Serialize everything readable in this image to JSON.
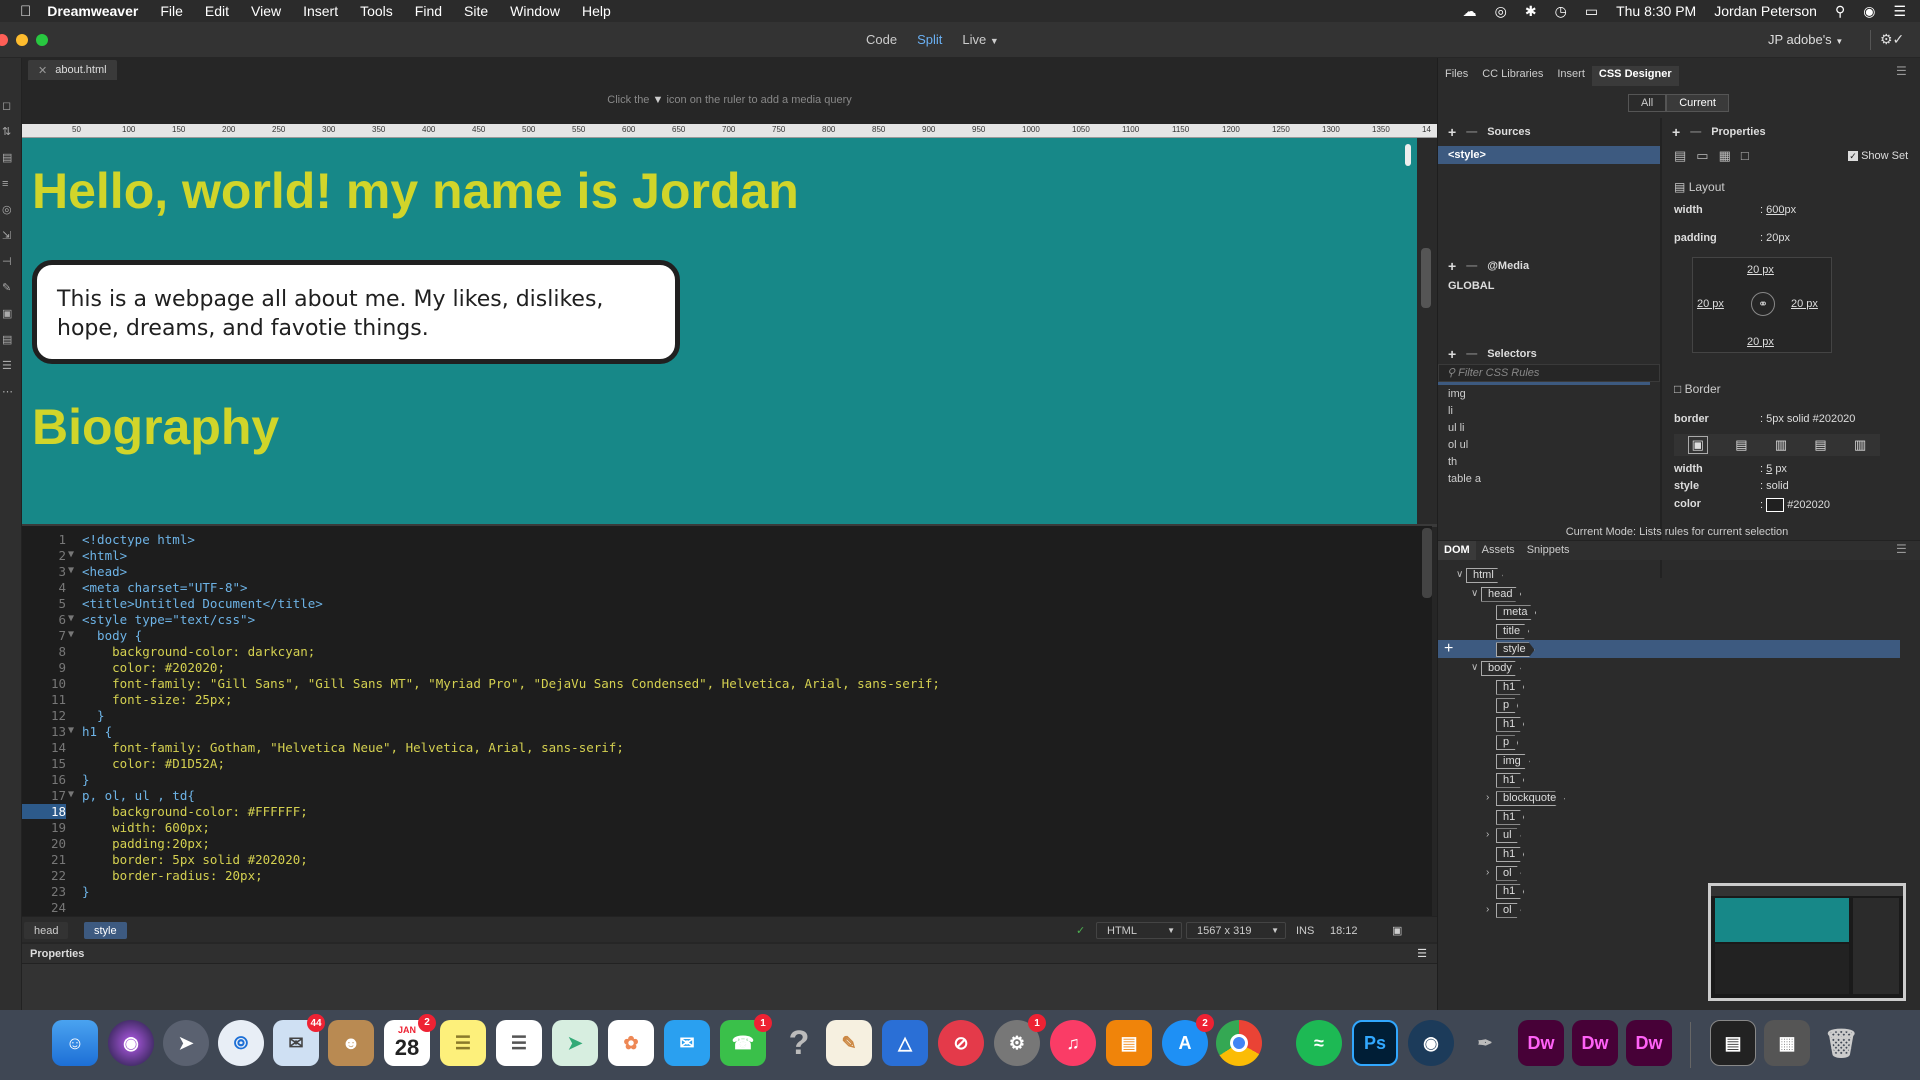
{
  "menubar": {
    "app": "Dreamweaver",
    "items": [
      "File",
      "Edit",
      "View",
      "Insert",
      "Tools",
      "Find",
      "Site",
      "Window",
      "Help"
    ],
    "clock": "Thu 8:30 PM",
    "user": "Jordan Peterson"
  },
  "titlebar": {
    "view_code": "Code",
    "view_split": "Split",
    "view_live": "Live",
    "account": "JP adobe's"
  },
  "document": {
    "tab_label": "about.html",
    "media_hint_left": "Click the",
    "media_hint_right": "icon on the ruler to add a media query",
    "ruler_ticks": [
      "50",
      "100",
      "150",
      "200",
      "250",
      "300",
      "350",
      "400",
      "450",
      "500",
      "550",
      "600",
      "650",
      "700",
      "750",
      "800",
      "850",
      "900",
      "950",
      "1000",
      "1050",
      "1100",
      "1150",
      "1200",
      "1250",
      "1300",
      "1350",
      "14"
    ]
  },
  "live_view": {
    "heading1": "Hello, world! my name is Jordan",
    "paragraph": "This is a webpage all about me. My likes, dislikes, hope, dreams, and favotie things.",
    "heading2": "Biography",
    "colors": {
      "background": "#178888",
      "heading": "#D1D52A",
      "text": "#202020"
    }
  },
  "code_lines": [
    {
      "n": "1",
      "fold": "",
      "text": "<!doctype html>"
    },
    {
      "n": "2",
      "fold": "▼",
      "text": "<html>"
    },
    {
      "n": "3",
      "fold": "▼",
      "text": "<head>"
    },
    {
      "n": "4",
      "fold": "",
      "text": "<meta charset=\"UTF-8\">"
    },
    {
      "n": "5",
      "fold": "",
      "text": "<title>Untitled Document</title>"
    },
    {
      "n": "6",
      "fold": "▼",
      "text": "<style type=\"text/css\">"
    },
    {
      "n": "7",
      "fold": "▼",
      "text": "  body {"
    },
    {
      "n": "8",
      "fold": "",
      "text": "    background-color: darkcyan;"
    },
    {
      "n": "9",
      "fold": "",
      "text": "    color: #202020;"
    },
    {
      "n": "10",
      "fold": "",
      "text": "    font-family: \"Gill Sans\", \"Gill Sans MT\", \"Myriad Pro\", \"DejaVu Sans Condensed\", Helvetica, Arial, sans-serif;"
    },
    {
      "n": "11",
      "fold": "",
      "text": "    font-size: 25px;"
    },
    {
      "n": "12",
      "fold": "",
      "text": "  }"
    },
    {
      "n": "13",
      "fold": "▼",
      "text": "h1 {"
    },
    {
      "n": "14",
      "fold": "",
      "text": "    font-family: Gotham, \"Helvetica Neue\", Helvetica, Arial, sans-serif;"
    },
    {
      "n": "15",
      "fold": "",
      "text": "    color: #D1D52A;"
    },
    {
      "n": "16",
      "fold": "",
      "text": "}"
    },
    {
      "n": "17",
      "fold": "▼",
      "text": "p, ol, ul , td{"
    },
    {
      "n": "18",
      "fold": "",
      "text": "    background-color: #FFFFFF;"
    },
    {
      "n": "19",
      "fold": "",
      "text": "    width: 600px;"
    },
    {
      "n": "20",
      "fold": "",
      "text": "    padding:20px;"
    },
    {
      "n": "21",
      "fold": "",
      "text": "    border: 5px solid #202020;"
    },
    {
      "n": "22",
      "fold": "",
      "text": "    border-radius: 20px;"
    },
    {
      "n": "23",
      "fold": "",
      "text": "}"
    },
    {
      "n": "24",
      "fold": "",
      "text": ""
    }
  ],
  "statusbar": {
    "breadcrumb": [
      "head",
      "style"
    ],
    "language": "HTML",
    "size": "1567 x 319",
    "mode": "INS",
    "position": "18:12"
  },
  "properties_panel": {
    "title": "Properties"
  },
  "right_panel": {
    "tabs": [
      "Files",
      "CC Libraries",
      "Insert",
      "CSS Designer"
    ],
    "seg_all": "All",
    "seg_current": "Current",
    "sources_title": "Sources",
    "source_item": "<style>",
    "media_title": "@Media",
    "media_item": "GLOBAL",
    "selectors_title": "Selectors",
    "filter_placeholder": "Filter CSS Rules",
    "selectors": [
      "img",
      "li",
      "ul li",
      "ol ul",
      "th",
      "table a"
    ],
    "properties_title": "Properties",
    "show_set": "Show Set",
    "layout_title": "Layout",
    "width_label": "width",
    "width_value": "600",
    "width_unit": "px",
    "padding_label": "padding",
    "padding_value": "20px",
    "box_top": "20 px",
    "box_left": "20 px",
    "box_right": "20 px",
    "box_bottom": "20 px",
    "border_title": "Border",
    "border_label": "border",
    "border_value": "5px solid #202020",
    "bwidth_label": "width",
    "bwidth_value": "5",
    "bwidth_unit": "px",
    "bstyle_label": "style",
    "bstyle_value": "solid",
    "bcolor_label": "color",
    "bcolor_value": "#202020",
    "current_mode": "Current Mode: Lists rules for current selection",
    "dom_tabs": [
      "DOM",
      "Assets",
      "Snippets"
    ]
  },
  "dom_tree": [
    {
      "label": "html",
      "caret": "v",
      "indent": 0
    },
    {
      "label": "head",
      "caret": "v",
      "indent": 1
    },
    {
      "label": "meta",
      "caret": "",
      "indent": 2
    },
    {
      "label": "title",
      "caret": "",
      "indent": 2
    },
    {
      "label": "style",
      "caret": "",
      "indent": 2,
      "selected": true
    },
    {
      "label": "body",
      "caret": "v",
      "indent": 1
    },
    {
      "label": "h1",
      "caret": "",
      "indent": 2
    },
    {
      "label": "p",
      "caret": "",
      "indent": 2
    },
    {
      "label": "h1",
      "caret": "",
      "indent": 2
    },
    {
      "label": "p",
      "caret": "",
      "indent": 2
    },
    {
      "label": "img",
      "caret": "",
      "indent": 2
    },
    {
      "label": "h1",
      "caret": "",
      "indent": 2
    },
    {
      "label": "blockquote",
      "caret": ">",
      "indent": 2
    },
    {
      "label": "h1",
      "caret": "",
      "indent": 2
    },
    {
      "label": "ul",
      "caret": ">",
      "indent": 2
    },
    {
      "label": "h1",
      "caret": "",
      "indent": 2
    },
    {
      "label": "ol",
      "caret": ">",
      "indent": 2
    },
    {
      "label": "h1",
      "caret": "",
      "indent": 2
    },
    {
      "label": "ol",
      "caret": ">",
      "indent": 2
    }
  ],
  "dock": {
    "calendar_month": "JAN",
    "calendar_day": "28",
    "badges": {
      "mail": "44",
      "calendar": "2",
      "facetime": "1",
      "settings": "1",
      "appstore": "2"
    },
    "dw_label": "Dw",
    "ps_label": "Ps"
  }
}
